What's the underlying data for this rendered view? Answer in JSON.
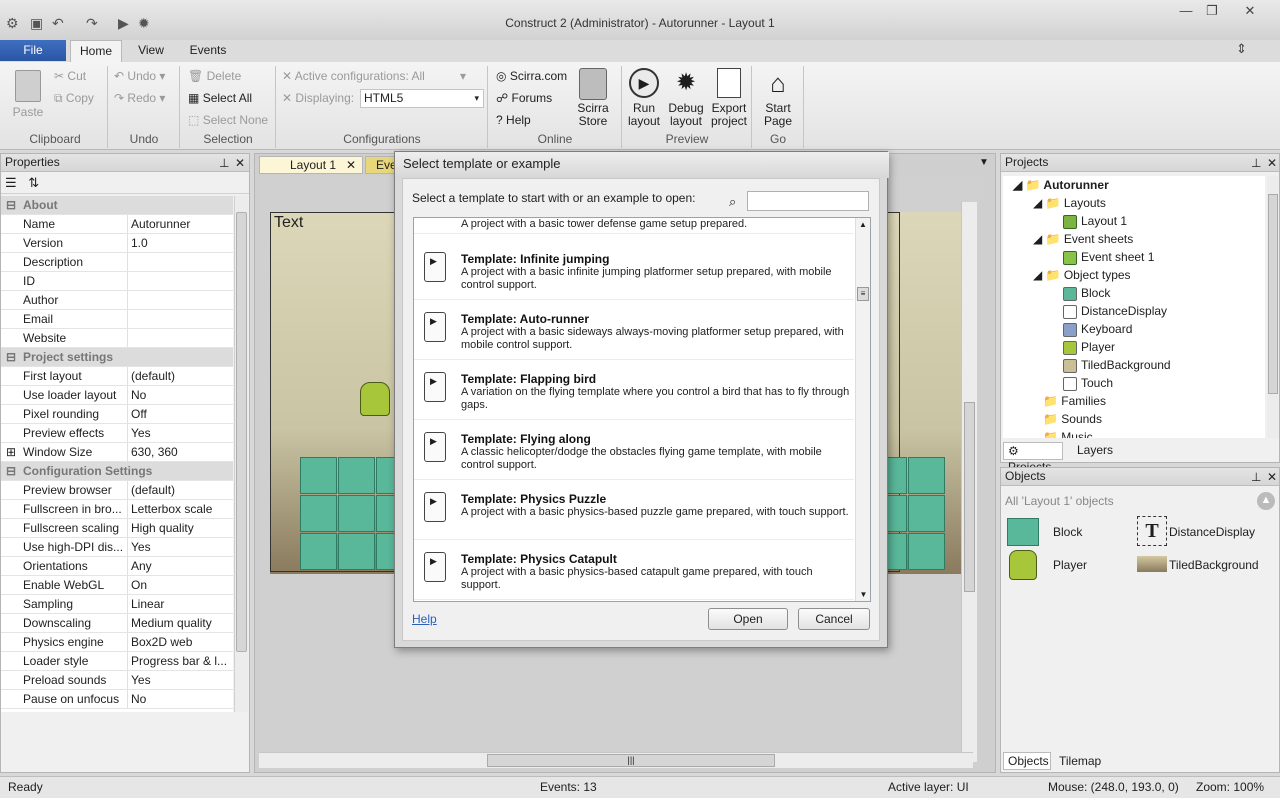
{
  "window": {
    "title": "Construct 2 (Administrator) - Autorunner - Layout 1"
  },
  "ribbon": {
    "tabs": [
      "File",
      "Home",
      "View",
      "Events"
    ],
    "clipboard": {
      "paste": "Paste",
      "cut": "Cut",
      "copy": "Copy",
      "label": "Clipboard"
    },
    "undo": {
      "undo": "Undo",
      "redo": "Redo",
      "label": "Undo"
    },
    "selection": {
      "delete": "Delete",
      "select_all": "Select All",
      "select_none": "Select None",
      "label": "Selection"
    },
    "configurations": {
      "active": "Active configurations: All",
      "displaying_label": "Displaying:",
      "displaying_value": "HTML5",
      "label": "Configurations"
    },
    "online": {
      "scirra": "Scirra.com",
      "forums": "Forums",
      "help": "Help",
      "store": "Scirra Store",
      "label": "Online"
    },
    "preview": {
      "run": "Run layout",
      "debug": "Debug layout",
      "export": "Export project",
      "label": "Preview"
    },
    "go": {
      "start": "Start Page",
      "label": "Go"
    }
  },
  "properties": {
    "title": "Properties",
    "rows": [
      {
        "section": "About"
      },
      {
        "k": "Name",
        "v": "Autorunner"
      },
      {
        "k": "Version",
        "v": "1.0"
      },
      {
        "k": "Description",
        "v": ""
      },
      {
        "k": "ID",
        "v": ""
      },
      {
        "k": "Author",
        "v": ""
      },
      {
        "k": "Email",
        "v": ""
      },
      {
        "k": "Website",
        "v": ""
      },
      {
        "section": "Project settings"
      },
      {
        "k": "First layout",
        "v": "(default)"
      },
      {
        "k": "Use loader layout",
        "v": "No"
      },
      {
        "k": "Pixel rounding",
        "v": "Off"
      },
      {
        "k": "Preview effects",
        "v": "Yes"
      },
      {
        "k": "Window Size",
        "v": "630, 360"
      },
      {
        "section": "Configuration Settings"
      },
      {
        "k": "Preview browser",
        "v": "(default)"
      },
      {
        "k": "Fullscreen in bro...",
        "v": "Letterbox scale"
      },
      {
        "k": "Fullscreen scaling",
        "v": "High quality"
      },
      {
        "k": "Use high-DPI dis...",
        "v": "Yes"
      },
      {
        "k": "Orientations",
        "v": "Any"
      },
      {
        "k": "Enable WebGL",
        "v": "On"
      },
      {
        "k": "Sampling",
        "v": "Linear"
      },
      {
        "k": "Downscaling",
        "v": "Medium quality"
      },
      {
        "k": "Physics engine",
        "v": "Box2D web"
      },
      {
        "k": "Loader style",
        "v": "Progress bar & l..."
      },
      {
        "k": "Preload sounds",
        "v": "Yes"
      },
      {
        "k": "Pause on unfocus",
        "v": "No"
      }
    ]
  },
  "editor": {
    "tab1": "Layout 1",
    "tab2": "Eve",
    "canvas_text": "Text"
  },
  "projects": {
    "title": "Projects",
    "root": "Autorunner",
    "layouts": "Layouts",
    "layout1": "Layout 1",
    "event_sheets": "Event sheets",
    "event_sheet1": "Event sheet 1",
    "object_types": "Object types",
    "objects": [
      "Block",
      "DistanceDisplay",
      "Keyboard",
      "Player",
      "TiledBackground",
      "Touch"
    ],
    "families": "Families",
    "sounds": "Sounds",
    "music": "Music",
    "tab_projects": "Projects",
    "tab_layers": "Layers"
  },
  "objects_panel": {
    "title": "Objects",
    "filter": "All 'Layout 1' objects",
    "items": [
      "Block",
      "DistanceDisplay",
      "Player",
      "TiledBackground"
    ],
    "tab_objects": "Objects",
    "tab_tilemap": "Tilemap"
  },
  "dialog": {
    "title": "Select template or example",
    "prompt": "Select a template to start with or an example to open:",
    "search_placeholder": "",
    "partial_top": "A project with a basic tower defense game setup prepared.",
    "items": [
      {
        "title": "Template: Infinite jumping",
        "desc": "A project with a basic infinite jumping platformer setup prepared, with mobile control support."
      },
      {
        "title": "Template: Auto-runner",
        "desc": "A project with a basic sideways always-moving platformer setup prepared, with mobile control support."
      },
      {
        "title": "Template: Flapping bird",
        "desc": "A variation on the flying template where you control a bird that has to fly through gaps."
      },
      {
        "title": "Template: Flying along",
        "desc": "A classic helicopter/dodge the obstacles flying game template, with mobile control support."
      },
      {
        "title": "Template: Physics Puzzle",
        "desc": "A project with a basic physics-based puzzle game prepared, with touch support."
      },
      {
        "title": "Template: Physics Catapult",
        "desc": "A project with a basic physics-based catapult game prepared, with touch support."
      }
    ],
    "help": "Help",
    "open": "Open",
    "cancel": "Cancel"
  },
  "status": {
    "ready": "Ready",
    "events": "Events: 13",
    "layer": "Active layer: UI",
    "mouse": "Mouse: (248.0, 193.0, 0)",
    "zoom": "Zoom: 100%"
  },
  "colors": {
    "accent": "#2a56a3",
    "tile": "#5ab89a",
    "sky": "#d9d3b4"
  }
}
